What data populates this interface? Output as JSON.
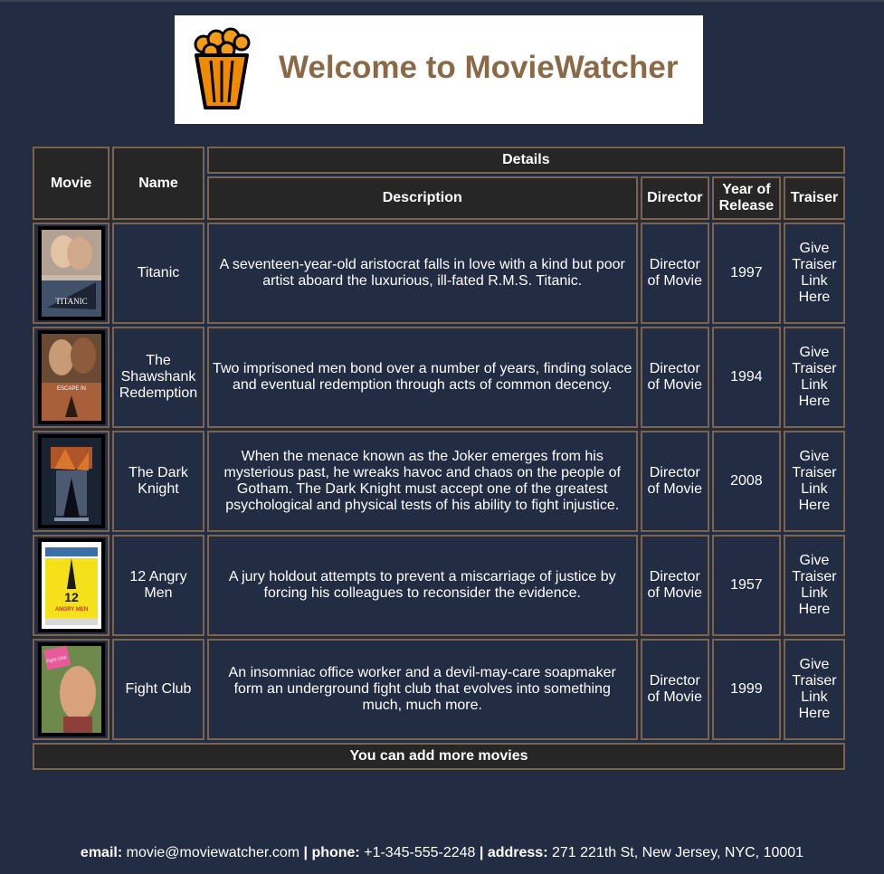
{
  "header": {
    "title": "Welcome to MovieWatcher",
    "logo_icon": "popcorn-icon"
  },
  "table": {
    "headers": {
      "movie": "Movie",
      "name": "Name",
      "details": "Details",
      "description": "Description",
      "director": "Director",
      "year": "Year of Release",
      "trailer": "Traiser"
    },
    "rows": [
      {
        "poster_icon": "titanic-poster",
        "poster_text": "TITANIC",
        "name": "Titanic",
        "description": "A seventeen-year-old aristocrat falls in love with a kind but poor artist aboard the luxurious, ill-fated R.M.S. Titanic.",
        "director": "Director of Movie",
        "year": "1997",
        "trailer": "Give Traiser Link Here"
      },
      {
        "poster_icon": "shawshank-poster",
        "poster_text": "ESCAPE IN",
        "name": "The Shawshank Redemption",
        "description": "Two imprisoned men bond over a number of years, finding solace and eventual redemption through acts of common decency.",
        "director": "Director of Movie",
        "year": "1994",
        "trailer": "Give Traiser Link Here"
      },
      {
        "poster_icon": "dark-knight-poster",
        "name": "The Dark Knight",
        "description": "When the menace known as the Joker emerges from his mysterious past, he wreaks havoc and chaos on the people of Gotham. The Dark Knight must accept one of the greatest psychological and physical tests of his ability to fight injustice.",
        "director": "Director of Movie",
        "year": "2008",
        "trailer": "Give Traiser Link Here"
      },
      {
        "poster_icon": "12-angry-men-poster",
        "poster_text": "12",
        "poster_subtext": "ANGRY MEN",
        "name": "12 Angry Men",
        "description": "A jury holdout attempts to prevent a miscarriage of justice by forcing his colleagues to reconsider the evidence.",
        "director": "Director of Movie",
        "year": "1957",
        "trailer": "Give Traiser Link Here"
      },
      {
        "poster_icon": "fight-club-poster",
        "poster_text": "Fight Club",
        "name": "Fight Club",
        "description": "An insomniac office worker and a devil-may-care soapmaker form an underground fight club that evolves into something much, much more.",
        "director": "Director of Movie",
        "year": "1999",
        "trailer": "Give Traiser Link Here"
      }
    ],
    "footer_row": "You can add more movies"
  },
  "footer": {
    "email_label": "email:",
    "email": "movie@moviewatcher.com",
    "phone_label": "phone:",
    "phone": "+1-345-555-2248",
    "address_label": "address:",
    "address": "271 221th St, New Jersey, NYC, 10001",
    "separator": "|"
  },
  "colors": {
    "background": "#222c43",
    "border": "#7d6349",
    "header_cell": "#262626",
    "title": "#8a6a46",
    "logo_orange": "#f08a00"
  }
}
